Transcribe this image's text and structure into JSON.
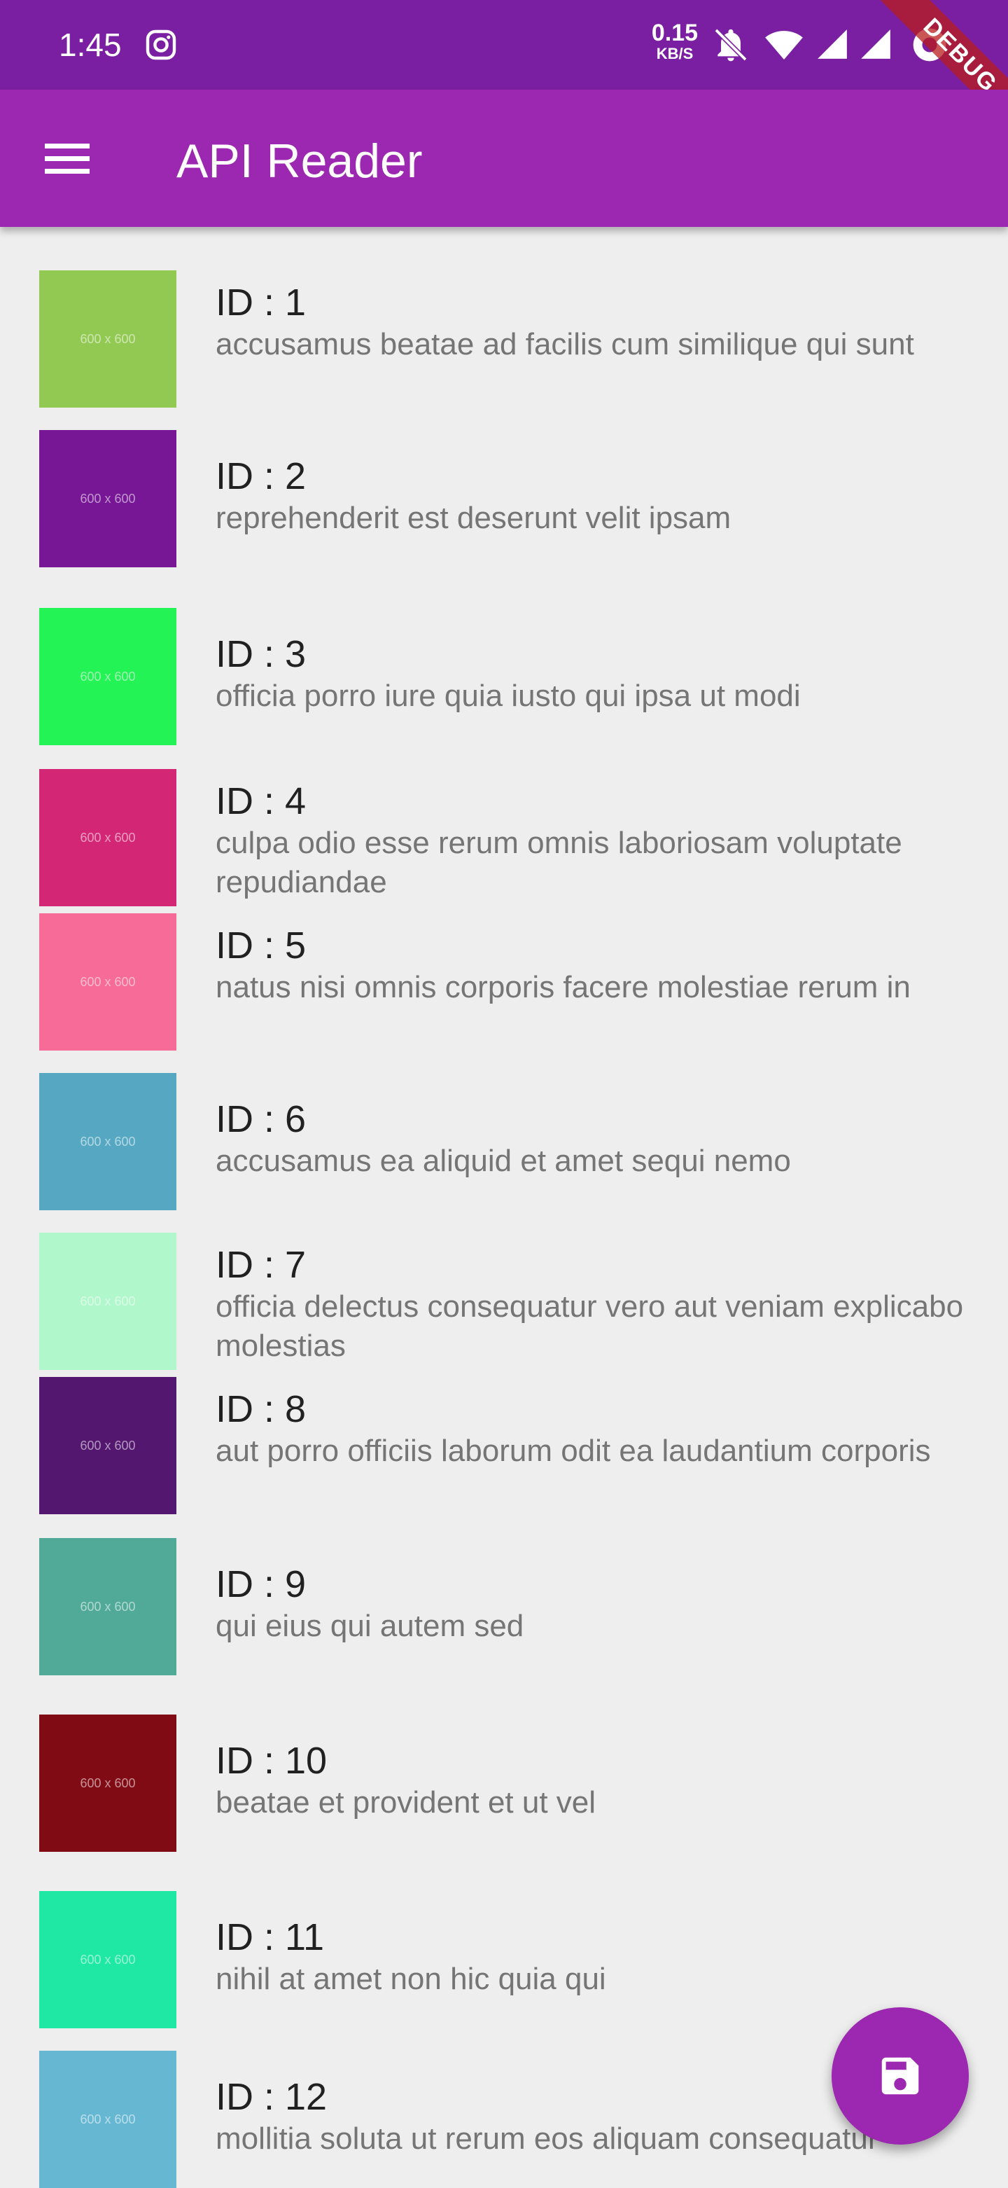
{
  "status_bar": {
    "time": "1:45",
    "net_speed": "0.15",
    "net_unit": "KB/S",
    "debug_label": "DEBUG",
    "icons": [
      "instagram-icon",
      "bell-off-icon",
      "wifi-icon",
      "signal-icon",
      "signal-icon",
      "dnd-icon"
    ]
  },
  "app_bar": {
    "title": "API Reader",
    "menu_icon": "hamburger-menu-icon",
    "color": "#9c27b0"
  },
  "items": [
    {
      "id_label": "ID : 1",
      "title": "accusamus beatae ad facilis cum similique qui sunt",
      "thumb_color": "#92c952",
      "thumb_text": "600 x 600"
    },
    {
      "id_label": "ID : 2",
      "title": "reprehenderit est deserunt velit ipsam",
      "thumb_color": "#771796",
      "thumb_text": "600 x 600"
    },
    {
      "id_label": "ID : 3",
      "title": "officia porro iure quia iusto qui ipsa ut modi",
      "thumb_color": "#24f355",
      "thumb_text": "600 x 600"
    },
    {
      "id_label": "ID : 4",
      "title": "culpa odio esse rerum omnis laboriosam voluptate repudiandae",
      "thumb_color": "#d32776",
      "thumb_text": "600 x 600"
    },
    {
      "id_label": "ID : 5",
      "title": "natus nisi omnis corporis facere molestiae rerum in",
      "thumb_color": "#f66b97",
      "thumb_text": "600 x 600"
    },
    {
      "id_label": "ID : 6",
      "title": "accusamus ea aliquid et amet sequi nemo",
      "thumb_color": "#56a8c2",
      "thumb_text": "600 x 600"
    },
    {
      "id_label": "ID : 7",
      "title": "officia delectus consequatur vero aut veniam explicabo molestias",
      "thumb_color": "#b0f7cc",
      "thumb_text": "600 x 600"
    },
    {
      "id_label": "ID : 8",
      "title": "aut porro officiis laborum odit ea laudantium corporis",
      "thumb_color": "#54176f",
      "thumb_text": "600 x 600"
    },
    {
      "id_label": "ID : 9",
      "title": "qui eius qui autem sed",
      "thumb_color": "#51aa97",
      "thumb_text": "600 x 600"
    },
    {
      "id_label": "ID : 10",
      "title": "beatae et provident et ut vel",
      "thumb_color": "#810b14",
      "thumb_text": "600 x 600"
    },
    {
      "id_label": "ID : 11",
      "title": "nihil at amet non hic quia qui",
      "thumb_color": "#1ee8a4",
      "thumb_text": "600 x 600"
    },
    {
      "id_label": "ID : 12",
      "title": "mollitia soluta ut rerum eos aliquam consequatur",
      "thumb_color": "#66b7d2",
      "thumb_text": "600 x 600"
    }
  ],
  "fab": {
    "icon": "save-icon",
    "color": "#9c27b0"
  }
}
